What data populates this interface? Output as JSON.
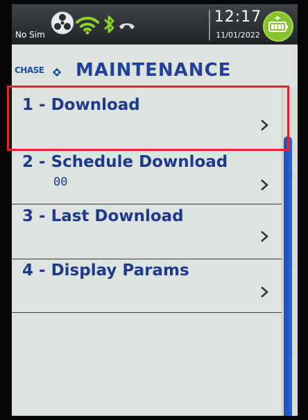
{
  "status": {
    "sim": "No Sim",
    "time": "12:17",
    "date": "11/01/2022"
  },
  "header": {
    "brand": "CHASE",
    "title": "MAINTENANCE"
  },
  "menu": {
    "items": [
      {
        "label": "1 - Download",
        "sub": ""
      },
      {
        "label": "2 - Schedule Download",
        "sub": "00"
      },
      {
        "label": "3 - Last Download",
        "sub": ""
      },
      {
        "label": "4 - Display Params",
        "sub": ""
      }
    ],
    "selected_index": 0
  },
  "colors": {
    "accent": "#22409a",
    "highlight": "#e2232a",
    "battery": "#86c22e"
  }
}
